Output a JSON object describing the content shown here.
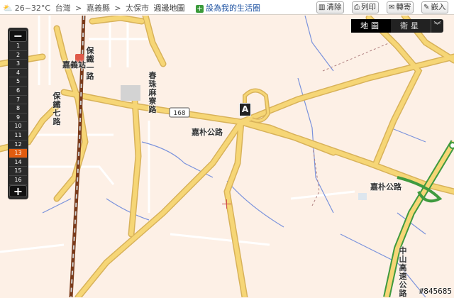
{
  "topbar": {
    "weather": "26~32°C",
    "breadcrumb": [
      "台灣",
      ">",
      "嘉義縣",
      ">",
      "太保市"
    ],
    "map_title": "週邊地圖",
    "set_link": "設為我的生活圈",
    "buttons": [
      {
        "label": "清除",
        "icon": "eraser-icon"
      },
      {
        "label": "列印",
        "icon": "printer-icon"
      },
      {
        "label": "轉寄",
        "icon": "forward-icon"
      },
      {
        "label": "嵌入",
        "icon": "embed-icon"
      }
    ]
  },
  "view_switch": {
    "map": "地圖",
    "satellite": "衛星",
    "more": "︾"
  },
  "zoom": {
    "minus": "−",
    "plus": "+",
    "levels": [
      "1",
      "2",
      "3",
      "4",
      "5",
      "6",
      "7",
      "8",
      "9",
      "10",
      "11",
      "12",
      "13",
      "14",
      "15",
      "16"
    ],
    "active_level": "13"
  },
  "marker": {
    "label": "A"
  },
  "labels": {
    "baotie_1": "保鐵一路",
    "baotie_7": "保鐵七路",
    "chiayi_station": "嘉義站",
    "chunzhu_road": "春珠麻寮路",
    "jiapu_road_1": "嘉朴公路",
    "jiapu_road_2": "嘉朴公路",
    "route_168": "168",
    "zhongshan_highway": "中山高速公路"
  },
  "stamp": "#845685",
  "colors": {
    "road": "#f6d676",
    "road_edge": "#d8b25a",
    "minor_road": "#ffffff",
    "water": "#6c8ad8",
    "bg": "#fdf0e6"
  }
}
